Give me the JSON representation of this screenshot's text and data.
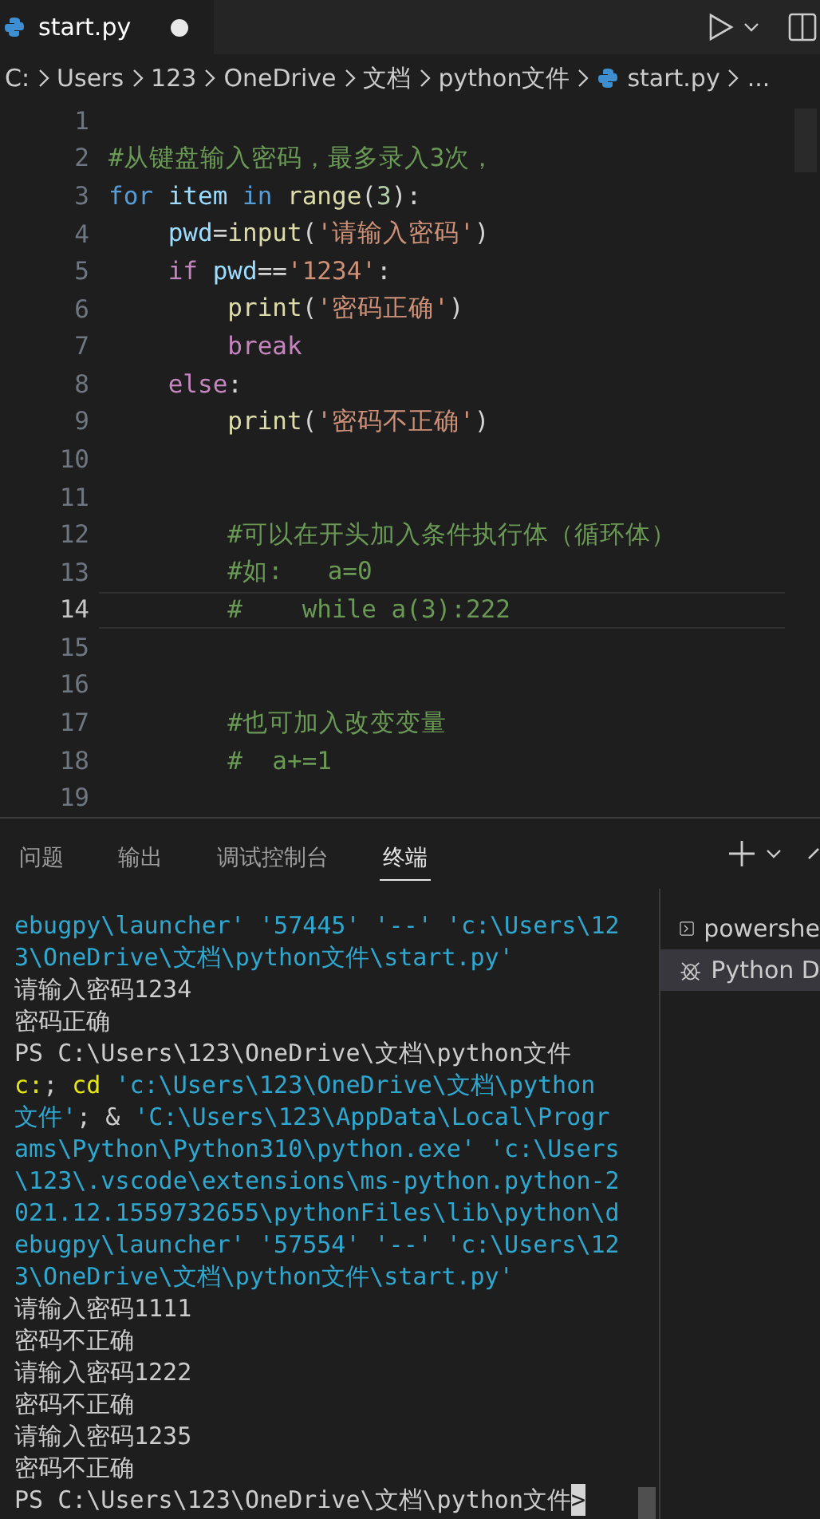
{
  "editor_tab": {
    "title": "start.py",
    "modified": true
  },
  "breadcrumb": [
    "C:",
    "Users",
    "123",
    "OneDrive",
    "文档",
    "python文件",
    "start.py",
    "..."
  ],
  "code_lines": [
    {
      "number": "1",
      "current": false
    },
    {
      "number": "2",
      "current": false,
      "tokens": [
        {
          "kind": "comment",
          "text": "#从键盘输入密码，最多录入3次，"
        }
      ]
    },
    {
      "number": "3",
      "current": false,
      "tokens": [
        {
          "kind": "keyword",
          "text": "for"
        },
        {
          "kind": "variable",
          "text": " item"
        },
        {
          "kind": "keyword",
          "text": " in"
        },
        {
          "kind": "func",
          "text": " range"
        },
        {
          "kind": "plain",
          "text": "("
        },
        {
          "kind": "number",
          "text": "3"
        },
        {
          "kind": "plain",
          "text": "):"
        }
      ]
    },
    {
      "number": "4",
      "current": false,
      "tokens": [
        {
          "kind": "variable",
          "text": "    pwd"
        },
        {
          "kind": "plain",
          "text": "="
        },
        {
          "kind": "func",
          "text": "input"
        },
        {
          "kind": "plain",
          "text": "("
        },
        {
          "kind": "string",
          "text": "'请输入密码'"
        },
        {
          "kind": "plain",
          "text": ")"
        }
      ]
    },
    {
      "number": "5",
      "current": false,
      "tokens": [
        {
          "kind": "control",
          "text": "    if"
        },
        {
          "kind": "variable",
          "text": " pwd"
        },
        {
          "kind": "plain",
          "text": "=="
        },
        {
          "kind": "string",
          "text": "'1234'"
        },
        {
          "kind": "plain",
          "text": ":"
        }
      ]
    },
    {
      "number": "6",
      "current": false,
      "tokens": [
        {
          "kind": "func",
          "text": "        print"
        },
        {
          "kind": "plain",
          "text": "("
        },
        {
          "kind": "string",
          "text": "'密码正确'"
        },
        {
          "kind": "plain",
          "text": ")"
        }
      ]
    },
    {
      "number": "7",
      "current": false,
      "tokens": [
        {
          "kind": "control",
          "text": "        break"
        }
      ]
    },
    {
      "number": "8",
      "current": false,
      "tokens": [
        {
          "kind": "control",
          "text": "    else"
        },
        {
          "kind": "plain",
          "text": ":"
        }
      ]
    },
    {
      "number": "9",
      "current": false,
      "tokens": [
        {
          "kind": "func",
          "text": "        print"
        },
        {
          "kind": "plain",
          "text": "("
        },
        {
          "kind": "string",
          "text": "'密码不正确'"
        },
        {
          "kind": "plain",
          "text": ")"
        }
      ]
    },
    {
      "number": "10",
      "current": false
    },
    {
      "number": "11",
      "current": false
    },
    {
      "number": "12",
      "current": false,
      "tokens": [
        {
          "kind": "comment",
          "text": "        #可以在开头加入条件执行体（循环体）"
        }
      ]
    },
    {
      "number": "13",
      "current": false,
      "tokens": [
        {
          "kind": "comment",
          "text": "        #如:   a=0"
        }
      ]
    },
    {
      "number": "14",
      "current": true,
      "tokens": [
        {
          "kind": "comment",
          "text": "        #    while a(3):222"
        }
      ]
    },
    {
      "number": "15",
      "current": false
    },
    {
      "number": "16",
      "current": false
    },
    {
      "number": "17",
      "current": false,
      "tokens": [
        {
          "kind": "comment",
          "text": "        #也可加入改变变量"
        }
      ]
    },
    {
      "number": "18",
      "current": false,
      "tokens": [
        {
          "kind": "comment",
          "text": "        #  a+=1"
        }
      ]
    },
    {
      "number": "19",
      "current": false
    }
  ],
  "panel_tabs": [
    {
      "label": "问题",
      "selected": false
    },
    {
      "label": "输出",
      "selected": false
    },
    {
      "label": "调试控制台",
      "selected": false
    },
    {
      "label": "终端",
      "selected": true
    }
  ],
  "terminal_lines": [
    [
      {
        "kind": "path",
        "text": "ebugpy\\launcher' '57445' '--' 'c:\\Users\\12"
      }
    ],
    [
      {
        "kind": "path",
        "text": "3\\OneDrive\\文档\\python文件\\start.py'"
      }
    ],
    [
      {
        "kind": "plain",
        "text": "请输入密码1234"
      }
    ],
    [
      {
        "kind": "plain",
        "text": "密码正确"
      }
    ],
    [
      {
        "kind": "plain",
        "text": "PS C:\\Users\\123\\OneDrive\\文档\\python文件"
      }
    ],
    [
      {
        "kind": "command",
        "text": "c:"
      },
      {
        "kind": "plain",
        "text": ";"
      },
      {
        "kind": "command",
        "text": " cd"
      },
      {
        "kind": "path",
        "text": " 'c:\\Users\\123\\OneDrive\\文档\\python"
      }
    ],
    [
      {
        "kind": "path",
        "text": "文件'"
      },
      {
        "kind": "plain",
        "text": "; &"
      },
      {
        "kind": "path",
        "text": " 'C:\\Users\\123\\AppData\\Local\\Progr"
      }
    ],
    [
      {
        "kind": "path",
        "text": "ams\\Python\\Python310\\python.exe' 'c:\\Users"
      }
    ],
    [
      {
        "kind": "path",
        "text": "\\123\\.vscode\\extensions\\ms-python.python-2"
      }
    ],
    [
      {
        "kind": "path",
        "text": "021.12.1559732655\\pythonFiles\\lib\\python\\d"
      }
    ],
    [
      {
        "kind": "path",
        "text": "ebugpy\\launcher' '57554' '--' 'c:\\Users\\12"
      }
    ],
    [
      {
        "kind": "path",
        "text": "3\\OneDrive\\文档\\python文件\\start.py'"
      }
    ],
    [
      {
        "kind": "plain",
        "text": "请输入密码1111"
      }
    ],
    [
      {
        "kind": "plain",
        "text": "密码不正确"
      }
    ],
    [
      {
        "kind": "plain",
        "text": "请输入密码1222"
      }
    ],
    [
      {
        "kind": "plain",
        "text": "密码不正确"
      }
    ],
    [
      {
        "kind": "plain",
        "text": "请输入密码1235"
      }
    ],
    [
      {
        "kind": "plain",
        "text": "密码不正确"
      }
    ],
    [
      {
        "kind": "plain",
        "text": "PS C:\\Users\\123\\OneDrive\\文档\\python文件"
      },
      {
        "kind": "cursor",
        "text": ">"
      }
    ]
  ],
  "terminals": [
    {
      "kind": "shell",
      "label": "powershe",
      "selected": false
    },
    {
      "kind": "debug",
      "label": "Python D",
      "selected": true
    }
  ]
}
